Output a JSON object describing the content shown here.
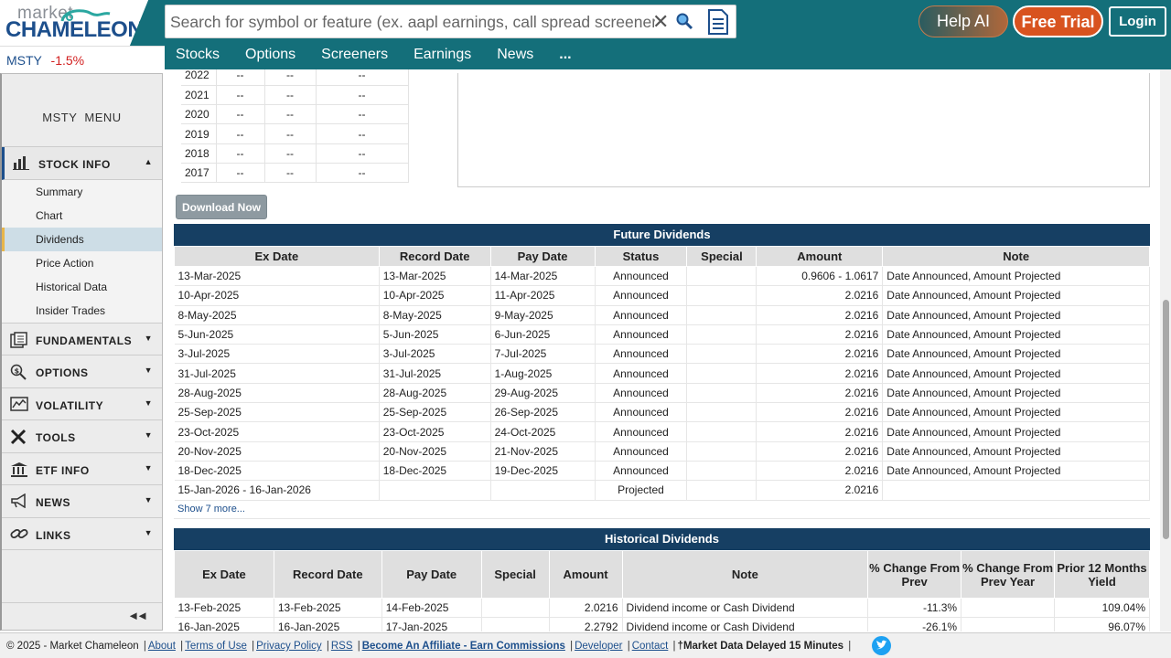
{
  "header": {
    "logo_top": "market",
    "logo_bottom": "CHAMELEON",
    "search_placeholder": "Search for symbol or feature (ex. aapl earnings, call spread screener)",
    "help_ai": "Help AI",
    "free_trial": "Free Trial",
    "login": "Login",
    "nav": [
      "Stocks",
      "Options",
      "Screeners",
      "Earnings",
      "News",
      "..."
    ]
  },
  "ticker": {
    "symbol": "MSTY",
    "change": "-1.5%"
  },
  "sidebar": {
    "menu_title": "MSTY  MENU",
    "stock_info": "STOCK INFO",
    "stock_info_items": [
      "Summary",
      "Chart",
      "Dividends",
      "Price Action",
      "Historical Data",
      "Insider Trades"
    ],
    "sections": [
      "FUNDAMENTALS",
      "OPTIONS",
      "VOLATILITY",
      "TOOLS",
      "ETF INFO",
      "NEWS",
      "LINKS"
    ],
    "collapse": "◄◄"
  },
  "years_table": [
    {
      "year": "2022",
      "a": "--",
      "b": "--",
      "c": "--"
    },
    {
      "year": "2021",
      "a": "--",
      "b": "--",
      "c": "--"
    },
    {
      "year": "2020",
      "a": "--",
      "b": "--",
      "c": "--"
    },
    {
      "year": "2019",
      "a": "--",
      "b": "--",
      "c": "--"
    },
    {
      "year": "2018",
      "a": "--",
      "b": "--",
      "c": "--"
    },
    {
      "year": "2017",
      "a": "--",
      "b": "--",
      "c": "--"
    }
  ],
  "download_label": "Download Now",
  "future": {
    "title": "Future Dividends",
    "headers": [
      "Ex Date",
      "Record Date",
      "Pay Date",
      "Status",
      "Special",
      "Amount",
      "Note"
    ],
    "rows": [
      [
        "13-Mar-2025",
        "13-Mar-2025",
        "14-Mar-2025",
        "Announced",
        "",
        "0.9606 - 1.0617",
        "Date Announced, Amount Projected"
      ],
      [
        "10-Apr-2025",
        "10-Apr-2025",
        "11-Apr-2025",
        "Announced",
        "",
        "2.0216",
        "Date Announced, Amount Projected"
      ],
      [
        "8-May-2025",
        "8-May-2025",
        "9-May-2025",
        "Announced",
        "",
        "2.0216",
        "Date Announced, Amount Projected"
      ],
      [
        "5-Jun-2025",
        "5-Jun-2025",
        "6-Jun-2025",
        "Announced",
        "",
        "2.0216",
        "Date Announced, Amount Projected"
      ],
      [
        "3-Jul-2025",
        "3-Jul-2025",
        "7-Jul-2025",
        "Announced",
        "",
        "2.0216",
        "Date Announced, Amount Projected"
      ],
      [
        "31-Jul-2025",
        "31-Jul-2025",
        "1-Aug-2025",
        "Announced",
        "",
        "2.0216",
        "Date Announced, Amount Projected"
      ],
      [
        "28-Aug-2025",
        "28-Aug-2025",
        "29-Aug-2025",
        "Announced",
        "",
        "2.0216",
        "Date Announced, Amount Projected"
      ],
      [
        "25-Sep-2025",
        "25-Sep-2025",
        "26-Sep-2025",
        "Announced",
        "",
        "2.0216",
        "Date Announced, Amount Projected"
      ],
      [
        "23-Oct-2025",
        "23-Oct-2025",
        "24-Oct-2025",
        "Announced",
        "",
        "2.0216",
        "Date Announced, Amount Projected"
      ],
      [
        "20-Nov-2025",
        "20-Nov-2025",
        "21-Nov-2025",
        "Announced",
        "",
        "2.0216",
        "Date Announced, Amount Projected"
      ],
      [
        "18-Dec-2025",
        "18-Dec-2025",
        "19-Dec-2025",
        "Announced",
        "",
        "2.0216",
        "Date Announced, Amount Projected"
      ],
      [
        "15-Jan-2026 - 16-Jan-2026",
        "",
        "",
        "Projected",
        "",
        "2.0216",
        ""
      ]
    ],
    "show_more": "Show 7 more..."
  },
  "historical": {
    "title": "Historical Dividends",
    "headers": [
      "Ex Date",
      "Record Date",
      "Pay Date",
      "Special",
      "Amount",
      "Note",
      "% Change From Prev",
      "% Change From Prev Year",
      "Prior 12 Months Yield"
    ],
    "rows": [
      [
        "13-Feb-2025",
        "13-Feb-2025",
        "14-Feb-2025",
        "",
        "2.0216",
        "Dividend income or Cash Dividend",
        "-11.3%",
        "",
        "109.04%"
      ],
      [
        "16-Jan-2025",
        "16-Jan-2025",
        "17-Jan-2025",
        "",
        "2.2792",
        "Dividend income or Cash Dividend",
        "-26.1%",
        "",
        "96.07%"
      ]
    ]
  },
  "footer": {
    "copyright": "© 2025 - Market Chameleon",
    "links": [
      "About",
      "Terms of Use",
      "Privacy Policy",
      "RSS",
      "Become An Affiliate - Earn Commissions",
      "Developer",
      "Contact"
    ],
    "delayed": "†Market Data Delayed 15 Minutes"
  },
  "colors": {
    "brand_teal": "#146f7a",
    "table_header": "#163f63",
    "negative": "#d21f1f",
    "free_trial": "#d8531f"
  }
}
